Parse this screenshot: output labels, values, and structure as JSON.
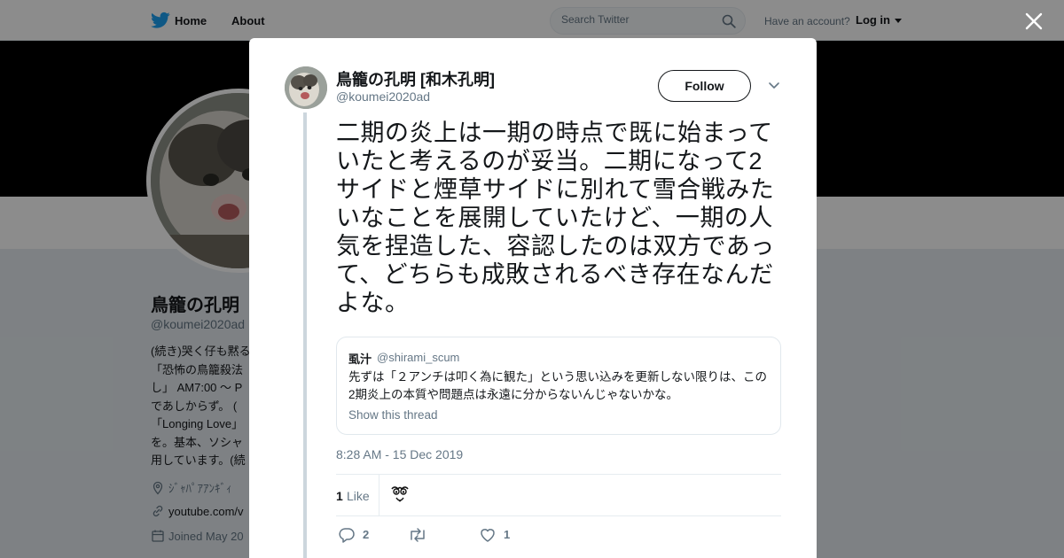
{
  "topnav": {
    "home_label": "Home",
    "about_label": "About",
    "search_placeholder": "Search Twitter",
    "have_account": "Have an account?",
    "login_label": "Log in",
    "brand_color": "#1da1f2"
  },
  "profile": {
    "name": "鳥籠の孔明",
    "handle": "@koumei2020ad",
    "bio_lines": [
      "(続き)哭く仔も黙る",
      "「恐怖の鳥籠殺法",
      "し」 AM7:00 ～ P",
      "であしからず。 (",
      "「Longing Love」",
      "を。基本、ソシャ",
      "用しています。(続"
    ],
    "location": "ｼﾞｬﾊﾟｱｱﾝｷﾞｨ",
    "website": "youtube.com/v",
    "joined": "Joined May 20"
  },
  "tweet": {
    "author_name": "鳥籠の孔明 [和木孔明]",
    "author_handle": "@koumei2020ad",
    "follow_label": "Follow",
    "text": "二期の炎上は一期の時点で既に始まっていたと考えるのが妥当。二期になって2サイドと煙草サイドに別れて雪合戦みたいなことを展開していたけど、一期の人気を捏造した、容認したのは双方であって、どちらも成敗されるべき存在なんだよな。",
    "quote": {
      "name": "虱汁",
      "handle": "@shirami_scum",
      "text": "先ずは「２アンチは叩く為に観た」という思い込みを更新しない限りは、この2期炎上の本質や問題点は永遠に分からないんじゃないかな。",
      "show_thread": "Show this thread"
    },
    "timestamp": "8:28 AM - 15 Dec 2019",
    "likes_count": "1",
    "likes_label": "Like",
    "reply_count": "2",
    "retweet_count": "",
    "like_action_count": "1"
  }
}
